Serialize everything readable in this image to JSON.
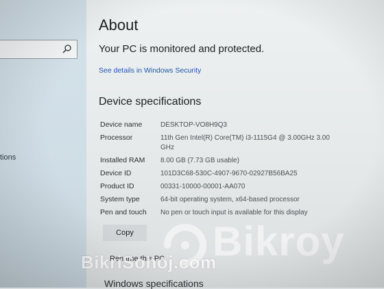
{
  "sidebar": {
    "search_placeholder": "",
    "items": [
      {
        "label": "tions"
      }
    ]
  },
  "main": {
    "title": "About",
    "protection_status": "Your PC is monitored and protected.",
    "security_link": "See details in Windows Security",
    "device_specs": {
      "heading": "Device specifications",
      "rows": [
        {
          "label": "Device name",
          "value": "DESKTOP-VO8H9Q3"
        },
        {
          "label": "Processor",
          "value": "11th Gen Intel(R) Core(TM) i3-1115G4 @ 3.00GHz   3.00 GHz"
        },
        {
          "label": "Installed RAM",
          "value": "8.00 GB (7.73 GB usable)"
        },
        {
          "label": "Device ID",
          "value": "101D3C68-530C-4907-9670-02927B56BA25"
        },
        {
          "label": "Product ID",
          "value": "00331-10000-00001-AA070"
        },
        {
          "label": "System type",
          "value": "64-bit operating system, x64-based processor"
        },
        {
          "label": "Pen and touch",
          "value": "No pen or touch input is available for this display"
        }
      ],
      "copy_label": "Copy"
    },
    "rename_label": "Rename this PC",
    "windows_specs_heading": "Windows specifications"
  },
  "watermarks": {
    "logo_text": "Bikroy",
    "site_text": "BikriSohoj.com"
  },
  "colors": {
    "link": "#1f56a8",
    "text": "#1c1f22",
    "button": "#d3d6d8"
  }
}
